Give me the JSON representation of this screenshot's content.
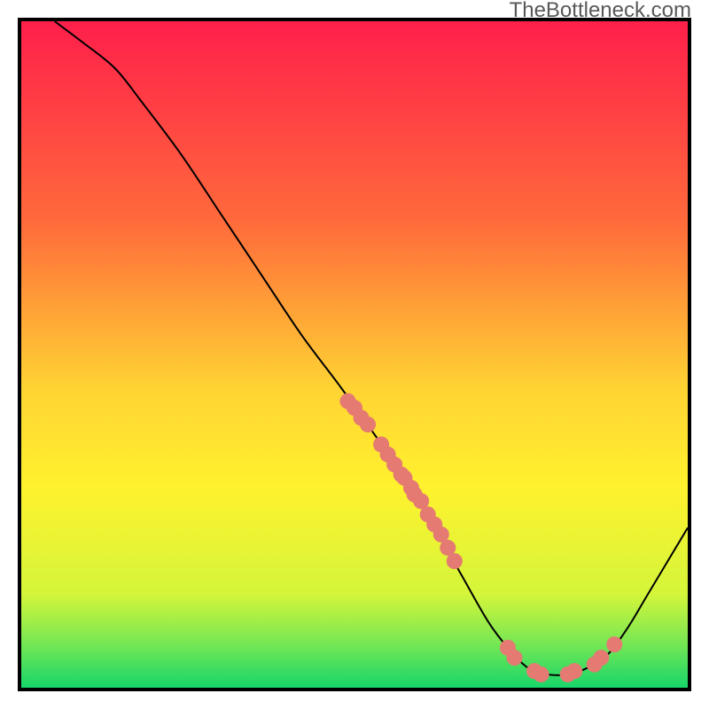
{
  "watermark": "TheBottleneck.com",
  "chart_data": {
    "type": "line",
    "title": "",
    "xlabel": "",
    "ylabel": "",
    "xlim": [
      0,
      100
    ],
    "ylim": [
      0,
      100
    ],
    "gradient_stops": [
      {
        "offset": 0,
        "color": "#ff1f4b"
      },
      {
        "offset": 0.3,
        "color": "#ff6a3b"
      },
      {
        "offset": 0.55,
        "color": "#ffd333"
      },
      {
        "offset": 0.7,
        "color": "#fff22e"
      },
      {
        "offset": 0.86,
        "color": "#d4f53a"
      },
      {
        "offset": 0.93,
        "color": "#7be852"
      },
      {
        "offset": 1.0,
        "color": "#17d66a"
      }
    ],
    "curve": [
      {
        "x": 5,
        "y": 100
      },
      {
        "x": 9,
        "y": 97
      },
      {
        "x": 14,
        "y": 93
      },
      {
        "x": 18,
        "y": 88
      },
      {
        "x": 24,
        "y": 80
      },
      {
        "x": 30,
        "y": 71
      },
      {
        "x": 36,
        "y": 62
      },
      {
        "x": 42,
        "y": 53
      },
      {
        "x": 48,
        "y": 45
      },
      {
        "x": 53,
        "y": 38
      },
      {
        "x": 58,
        "y": 31
      },
      {
        "x": 62,
        "y": 24
      },
      {
        "x": 66,
        "y": 17
      },
      {
        "x": 70,
        "y": 10
      },
      {
        "x": 73,
        "y": 6
      },
      {
        "x": 76,
        "y": 3
      },
      {
        "x": 79,
        "y": 2
      },
      {
        "x": 82,
        "y": 2
      },
      {
        "x": 85,
        "y": 3
      },
      {
        "x": 88,
        "y": 5
      },
      {
        "x": 91,
        "y": 9
      },
      {
        "x": 94,
        "y": 14
      },
      {
        "x": 97,
        "y": 19
      },
      {
        "x": 100,
        "y": 24
      }
    ],
    "dots": [
      {
        "x": 49,
        "y": 43
      },
      {
        "x": 50,
        "y": 42
      },
      {
        "x": 51,
        "y": 40.5
      },
      {
        "x": 52,
        "y": 39.5
      },
      {
        "x": 54,
        "y": 36.5
      },
      {
        "x": 55,
        "y": 35
      },
      {
        "x": 56,
        "y": 33.5
      },
      {
        "x": 57,
        "y": 32
      },
      {
        "x": 57.5,
        "y": 31.5
      },
      {
        "x": 58.5,
        "y": 30
      },
      {
        "x": 59,
        "y": 29
      },
      {
        "x": 60,
        "y": 28
      },
      {
        "x": 61,
        "y": 26
      },
      {
        "x": 62,
        "y": 24.5
      },
      {
        "x": 63,
        "y": 23
      },
      {
        "x": 64,
        "y": 21
      },
      {
        "x": 65,
        "y": 19
      },
      {
        "x": 73,
        "y": 6
      },
      {
        "x": 74,
        "y": 4.5
      },
      {
        "x": 77,
        "y": 2.5
      },
      {
        "x": 78,
        "y": 2
      },
      {
        "x": 82,
        "y": 2
      },
      {
        "x": 83,
        "y": 2.5
      },
      {
        "x": 86,
        "y": 3.5
      },
      {
        "x": 87,
        "y": 4.5
      },
      {
        "x": 89,
        "y": 6.5
      }
    ],
    "dot_color": "#e57a73",
    "dot_radius": 1.2
  }
}
